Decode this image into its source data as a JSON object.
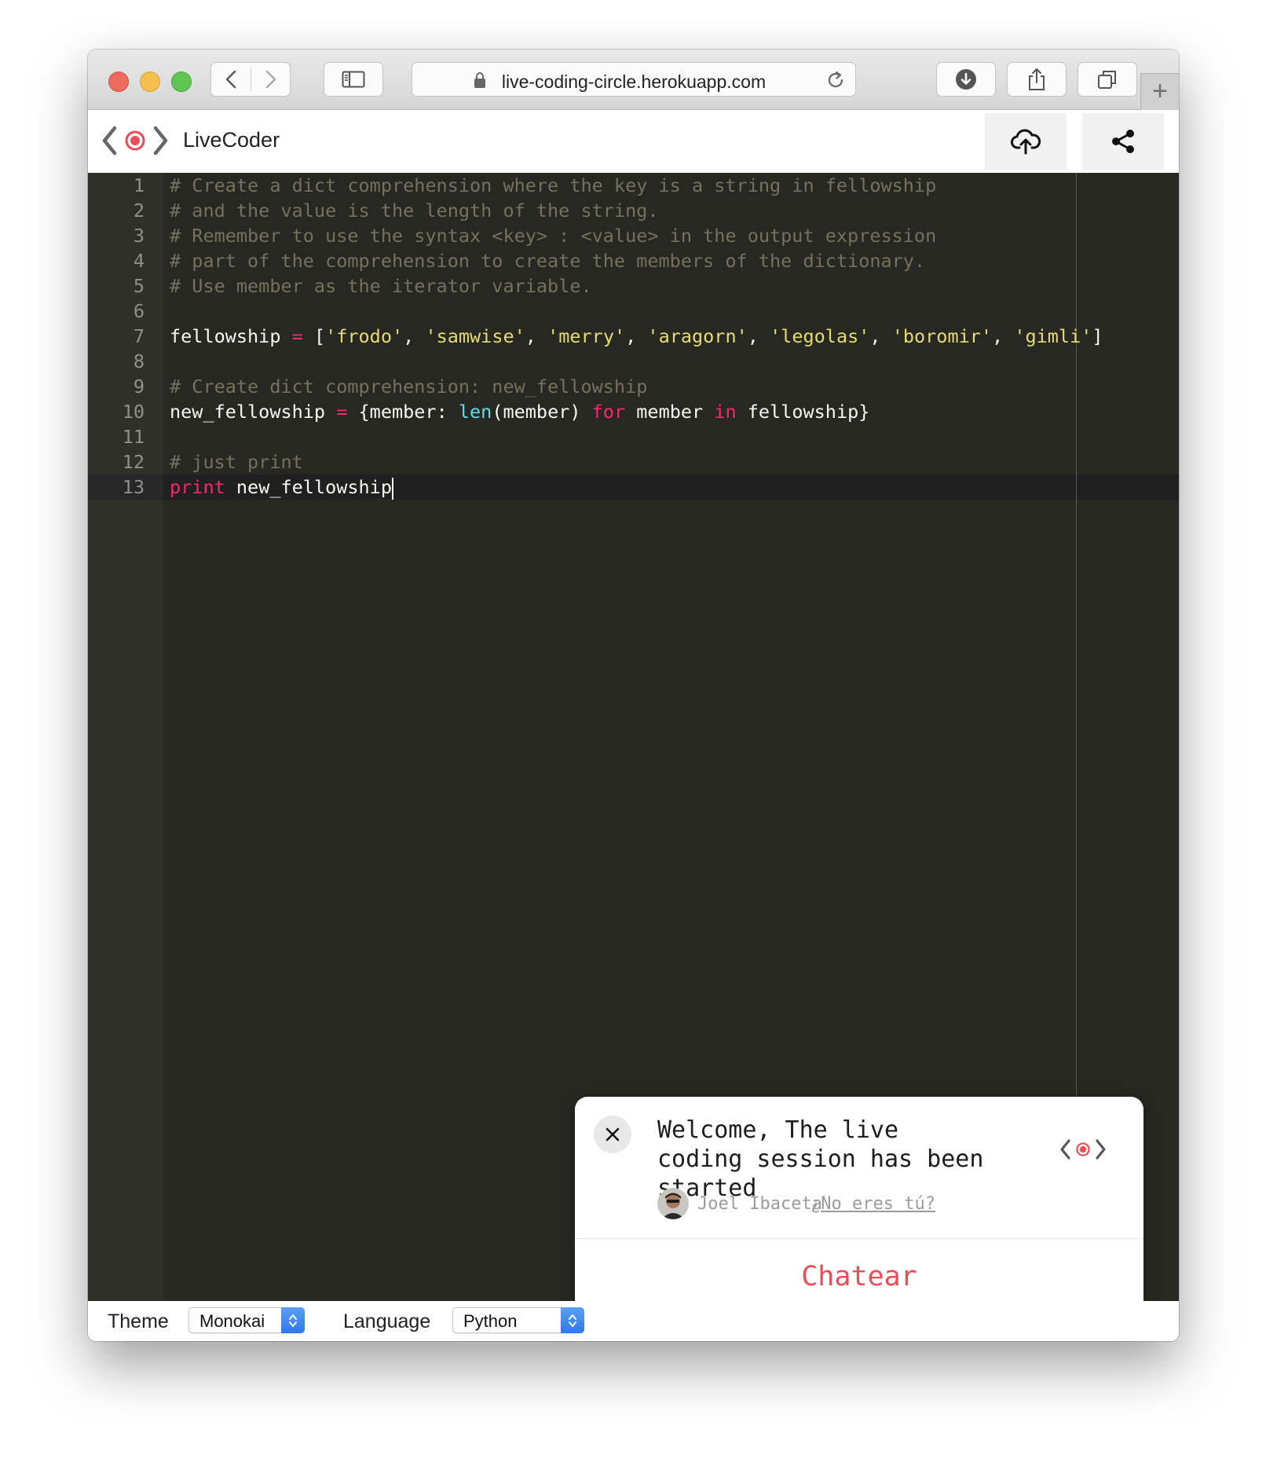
{
  "browser": {
    "url": "live-coding-circle.herokuapp.com",
    "new_tab_symbol": "+"
  },
  "app": {
    "title": "LiveCoder"
  },
  "editor": {
    "lines": [
      {
        "num": "1",
        "text": "# Create a dict comprehension where the key is a string in fellowship"
      },
      {
        "num": "2",
        "text": "# and the value is the length of the string."
      },
      {
        "num": "3",
        "text": "# Remember to use the syntax <key> : <value> in the output expression"
      },
      {
        "num": "4",
        "text": "# part of the comprehension to create the members of the dictionary."
      },
      {
        "num": "5",
        "text": "# Use member as the iterator variable."
      },
      {
        "num": "6",
        "text": ""
      },
      {
        "num": "7",
        "text": "fellowship = ['frodo', 'samwise', 'merry', 'aragorn', 'legolas', 'boromir', 'gimli']"
      },
      {
        "num": "8",
        "text": ""
      },
      {
        "num": "9",
        "text": "# Create dict comprehension: new_fellowship"
      },
      {
        "num": "10",
        "text": "new_fellowship = {member: len(member) for member in fellowship}"
      },
      {
        "num": "11",
        "text": ""
      },
      {
        "num": "12",
        "text": "# just print"
      },
      {
        "num": "13",
        "text": "print new_fellowship"
      }
    ],
    "colors": {
      "background": "#272822",
      "comment": "#75715e",
      "string": "#e6db74",
      "keyword": "#f92672",
      "builtin": "#66d9ef",
      "text": "#f8f8f2"
    }
  },
  "chat_popup": {
    "message": "Welcome, The live coding session has been started",
    "user_name": "Joel Ibaceta",
    "not_you_link": "¿No eres tú?",
    "chat_button": "Chatear",
    "accent_color": "#e94e58"
  },
  "statusbar": {
    "theme_label": "Theme",
    "theme_value": "Monokai",
    "language_label": "Language",
    "language_value": "Python"
  },
  "icons": {
    "logo": "live-coder-logo-icon",
    "upload": "cloud-upload-icon",
    "share": "share-icon",
    "messenger": "messenger-icon"
  }
}
